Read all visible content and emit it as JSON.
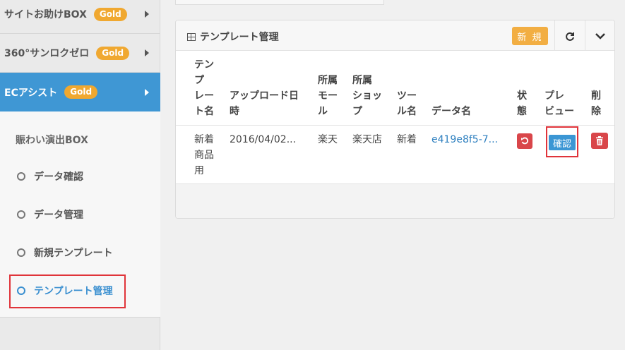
{
  "sidebar": {
    "items": [
      {
        "label": "サイトお助けBOX",
        "badge": "Gold"
      },
      {
        "label": "360°サンロクゼロ",
        "badge": "Gold"
      },
      {
        "label": "ECアシスト",
        "badge": "Gold"
      }
    ],
    "section_title": "賑わい演出BOX",
    "links": [
      "データ確認",
      "データ管理",
      "新規テンプレート",
      "テンプレート管理"
    ]
  },
  "panel": {
    "title": "テンプレート管理",
    "new_button": "新 規",
    "refresh_icon": "refresh-icon",
    "collapse_icon": "chevron-down-icon"
  },
  "table": {
    "headers": {
      "template_name": [
        "テン",
        "プ",
        "レー",
        "ト名"
      ],
      "upload_date": [
        "アップロード日",
        "時"
      ],
      "mall": [
        "所属",
        "モー",
        "ル"
      ],
      "shop": [
        "所属",
        "ショッ",
        "プ"
      ],
      "tool": [
        "ツー",
        "ル名"
      ],
      "data_name": [
        "データ名"
      ],
      "status": [
        "状",
        "態"
      ],
      "preview": [
        "プレ",
        "ビュー"
      ],
      "delete": [
        "削",
        "除"
      ]
    },
    "rows": [
      {
        "template_name": [
          "新着",
          "商品",
          "用"
        ],
        "upload_date": "2016/04/02...",
        "mall": "楽天",
        "shop": "楽天店",
        "tool": "新着",
        "data_name": "e419e8f5-7...",
        "preview_button": "確認"
      }
    ]
  },
  "colors": {
    "accent": "#3f97d4",
    "gold": "#f0a830",
    "danger": "#d9464a",
    "highlight": "#e0343a"
  }
}
